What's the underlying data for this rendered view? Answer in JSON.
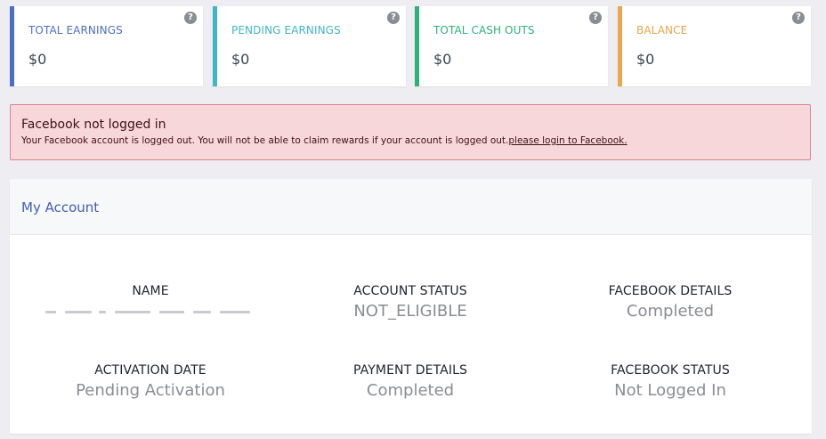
{
  "stats": [
    {
      "label": "TOTAL EARNINGS",
      "value": "$0",
      "color": "#4b6fc9"
    },
    {
      "label": "PENDING EARNINGS",
      "value": "$0",
      "color": "#3fb7c8"
    },
    {
      "label": "TOTAL CASH OUTS",
      "value": "$0",
      "color": "#2bb27c"
    },
    {
      "label": "BALANCE",
      "value": "$0",
      "color": "#eaa64b"
    }
  ],
  "help_icon_glyph": "?",
  "alert": {
    "title": "Facebook not logged in",
    "message": "Your Facebook account is logged out. You will not be able to claim rewards if your account is logged out.",
    "link": "please login to Facebook."
  },
  "account": {
    "title": "My Account",
    "fields": {
      "name": {
        "label": "NAME",
        "value": ""
      },
      "account_status": {
        "label": "ACCOUNT STATUS",
        "value": "NOT_ELIGIBLE"
      },
      "facebook_details": {
        "label": "FACEBOOK DETAILS",
        "value": "Completed"
      },
      "activation_date": {
        "label": "ACTIVATION DATE",
        "value": "Pending Activation"
      },
      "payment_details": {
        "label": "PAYMENT DETAILS",
        "value": "Completed"
      },
      "facebook_status": {
        "label": "FACEBOOK STATUS",
        "value": "Not Logged In"
      }
    }
  }
}
